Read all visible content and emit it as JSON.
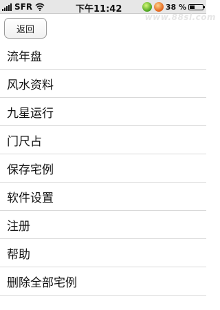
{
  "status_bar": {
    "carrier": "SFR",
    "time": "下午11:42",
    "battery_text": "38 %",
    "battery_level": 0.38,
    "icons": [
      "signal-icon",
      "wifi-icon",
      "app-icon-green",
      "app-icon-orange",
      "battery-icon"
    ]
  },
  "watermark": "www.88sl.com",
  "nav": {
    "back_label": "返回"
  },
  "menu": {
    "items": [
      {
        "label": "流年盘"
      },
      {
        "label": "风水资料"
      },
      {
        "label": "九星运行"
      },
      {
        "label": "门尺占"
      },
      {
        "label": "保存宅例"
      },
      {
        "label": "软件设置"
      },
      {
        "label": "注册"
      },
      {
        "label": "帮助"
      },
      {
        "label": "删除全部宅例"
      }
    ]
  }
}
